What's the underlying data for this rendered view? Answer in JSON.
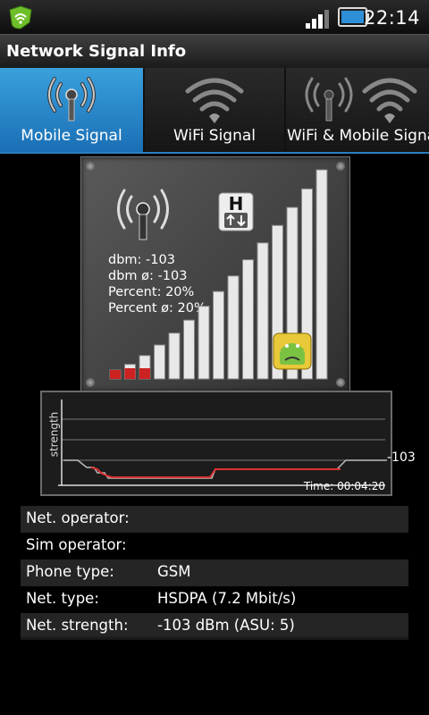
{
  "status_bar": {
    "time": "22:14",
    "app_icon": "security-shield-icon",
    "signal_icon": "cell-signal-icon",
    "battery_icon": "battery-icon"
  },
  "app": {
    "title": "Network Signal Info"
  },
  "tabs": [
    {
      "label": "Mobile Signal",
      "icon": "antenna-icon",
      "selected": true
    },
    {
      "label": "WiFi Signal",
      "icon": "wifi-icon",
      "selected": false
    },
    {
      "label": "WiFi & Mobile Signa",
      "icon": "antenna-wifi-icon",
      "selected": false
    }
  ],
  "widget": {
    "network_badge": "H",
    "stats": [
      {
        "label": "dbm",
        "value": "-103"
      },
      {
        "label": "dbm ø",
        "value": "-103"
      },
      {
        "label": "Percent",
        "value": "20%"
      },
      {
        "label": "Percent ø",
        "value": "20%"
      }
    ],
    "signal_level": 0.2,
    "accent_color": "#cc2222"
  },
  "graph": {
    "y_axis_label": "strength",
    "current_value": "-103",
    "time": "Time: 00:04:20",
    "line_color": "#cc3333"
  },
  "info_rows": [
    {
      "key": "Net. operator:",
      "value": ""
    },
    {
      "key": "Sim operator:",
      "value": ""
    },
    {
      "key": "Phone type:",
      "value": "GSM"
    },
    {
      "key": "Net. type:",
      "value": "HSDPA (7.2 Mbit/s)"
    },
    {
      "key": "Net. strength:",
      "value": "-103 dBm (ASU: 5)"
    }
  ]
}
